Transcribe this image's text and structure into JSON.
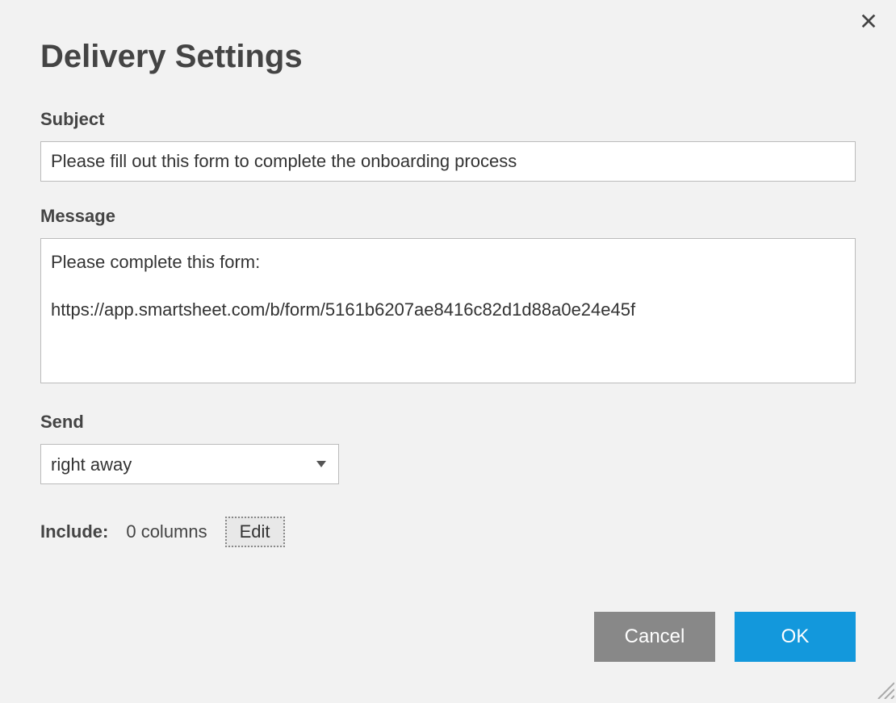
{
  "dialog": {
    "title": "Delivery Settings"
  },
  "fields": {
    "subject": {
      "label": "Subject",
      "value": "Please fill out this form to complete the onboarding process"
    },
    "message": {
      "label": "Message",
      "value": "Please complete this form:\n\nhttps://app.smartsheet.com/b/form/5161b6207ae8416c82d1d88a0e24e45f"
    },
    "send": {
      "label": "Send",
      "selected": "right away"
    },
    "include": {
      "label": "Include:",
      "value": "0 columns",
      "edit_label": "Edit"
    }
  },
  "buttons": {
    "cancel": "Cancel",
    "ok": "OK"
  }
}
